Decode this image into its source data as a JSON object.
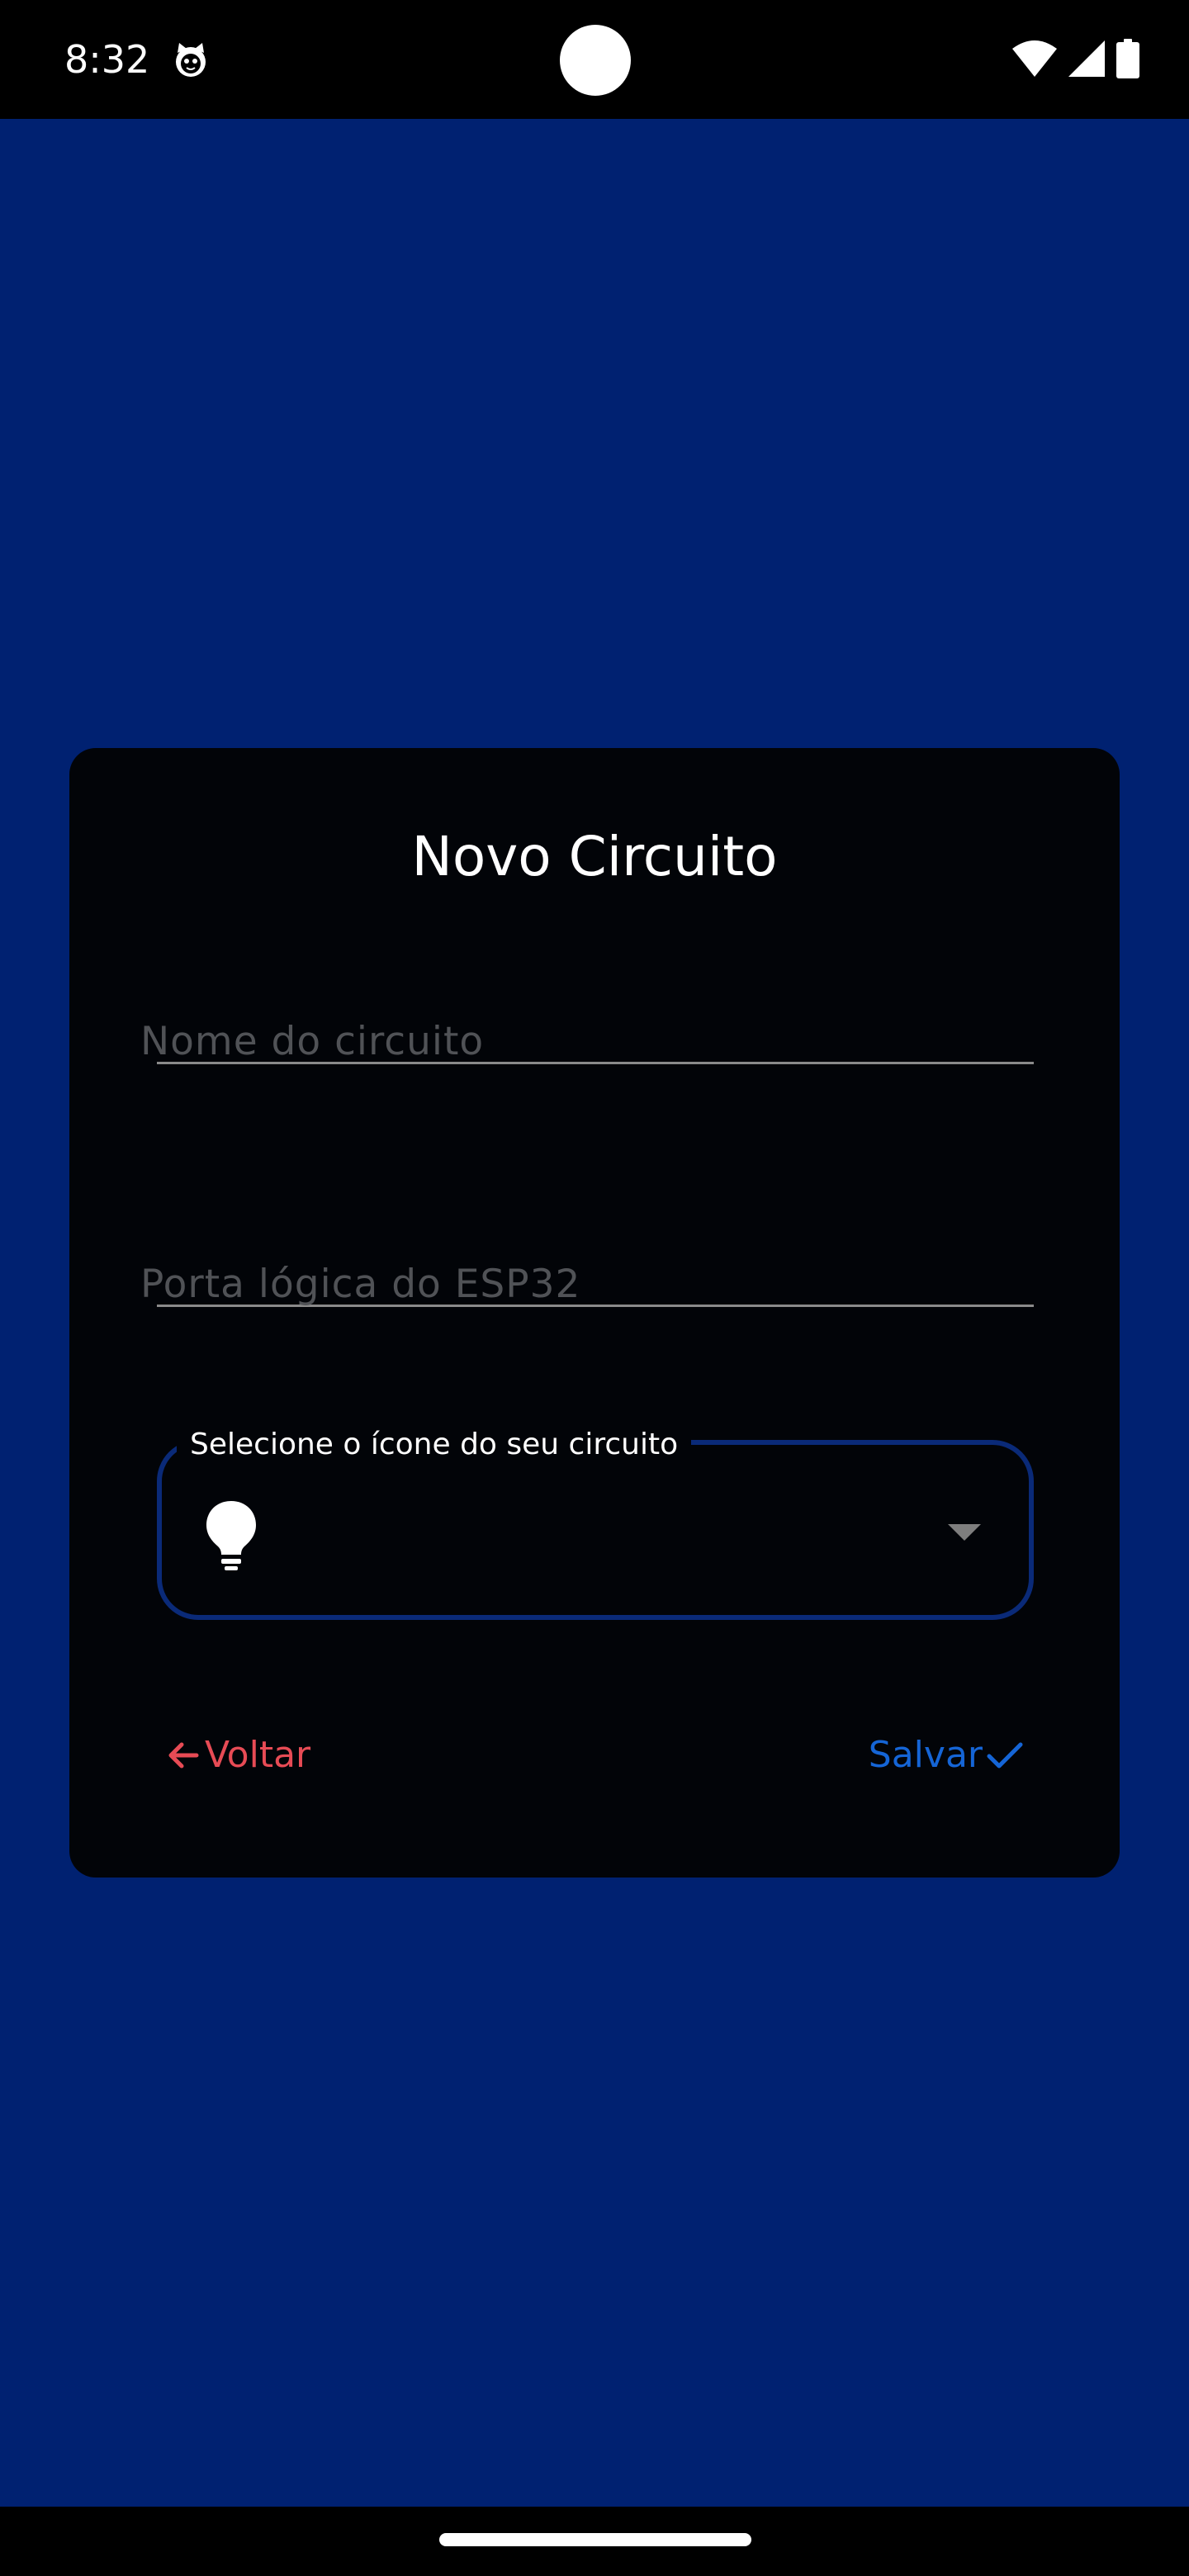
{
  "status_bar": {
    "time": "8:32",
    "app_icon": "cat-face-icon",
    "icons": [
      "wifi-icon",
      "cellular-signal-icon",
      "battery-icon"
    ]
  },
  "dialog": {
    "title": "Novo Circuito",
    "name_field": {
      "placeholder": "Nome do circuito",
      "value": ""
    },
    "port_field": {
      "placeholder": "Porta lógica do ESP32",
      "value": ""
    },
    "icon_dropdown": {
      "label": "Selecione o ícone do seu circuito",
      "selected_icon": "lightbulb-icon"
    },
    "back_button": {
      "label": "Voltar",
      "icon": "arrow-left-icon"
    },
    "save_button": {
      "label": "Salvar",
      "icon": "check-icon"
    }
  },
  "colors": {
    "background": "#002171",
    "dialog": "#020408",
    "back": "#e74b55",
    "save": "#1565d6",
    "dropdown_border": "#0a2a78"
  }
}
